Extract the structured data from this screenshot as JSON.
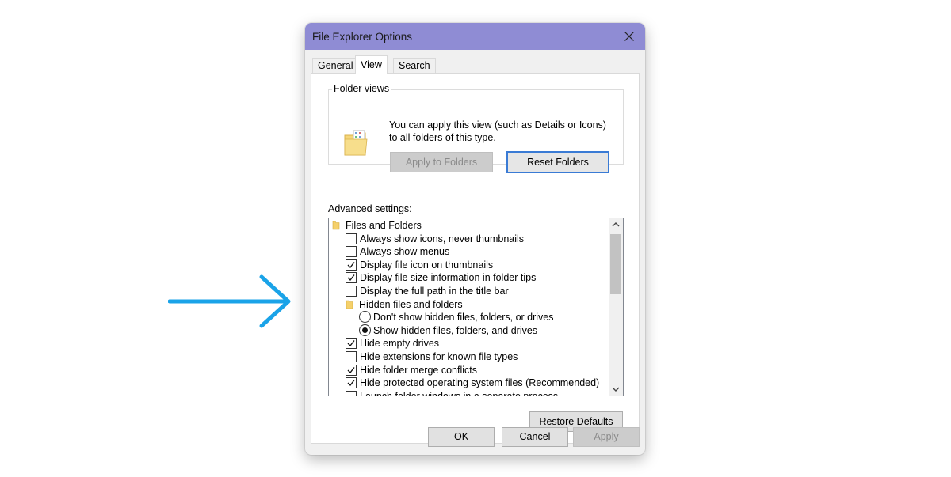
{
  "dialog": {
    "title": "File Explorer Options",
    "tabs": [
      {
        "label": "General"
      },
      {
        "label": "View"
      },
      {
        "label": "Search"
      }
    ],
    "active_tab": "View"
  },
  "folder_views": {
    "label": "Folder views",
    "description": "You can apply this view (such as Details or Icons) to all folders of this type.",
    "apply_label": "Apply to Folders",
    "reset_label": "Reset Folders"
  },
  "advanced": {
    "label": "Advanced settings:",
    "items": [
      {
        "type": "folder",
        "label": "Files and Folders"
      },
      {
        "type": "checkbox",
        "label": "Always show icons, never thumbnails",
        "checked": false
      },
      {
        "type": "checkbox",
        "label": "Always show menus",
        "checked": false
      },
      {
        "type": "checkbox",
        "label": "Display file icon on thumbnails",
        "checked": true
      },
      {
        "type": "checkbox",
        "label": "Display file size information in folder tips",
        "checked": true
      },
      {
        "type": "checkbox",
        "label": "Display the full path in the title bar",
        "checked": false
      },
      {
        "type": "folder",
        "label": "Hidden files and folders"
      },
      {
        "type": "radio",
        "label": "Don't show hidden files, folders, or drives",
        "checked": false
      },
      {
        "type": "radio",
        "label": "Show hidden files, folders, and drives",
        "checked": true
      },
      {
        "type": "checkbox",
        "label": "Hide empty drives",
        "checked": true
      },
      {
        "type": "checkbox",
        "label": "Hide extensions for known file types",
        "checked": false
      },
      {
        "type": "checkbox",
        "label": "Hide folder merge conflicts",
        "checked": true
      },
      {
        "type": "checkbox",
        "label": "Hide protected operating system files (Recommended)",
        "checked": true
      },
      {
        "type": "checkbox",
        "label": "Launch folder windows in a separate process",
        "checked": false
      }
    ]
  },
  "restore_label": "Restore Defaults",
  "footer": {
    "ok_label": "OK",
    "cancel_label": "Cancel",
    "apply_label": "Apply"
  },
  "colors": {
    "titlebar": "#8f8cd4",
    "arrow": "#1aa3e8"
  },
  "icons": {
    "close": "close-icon",
    "folder": "folder-icon",
    "arrow": "arrow-right-icon"
  }
}
